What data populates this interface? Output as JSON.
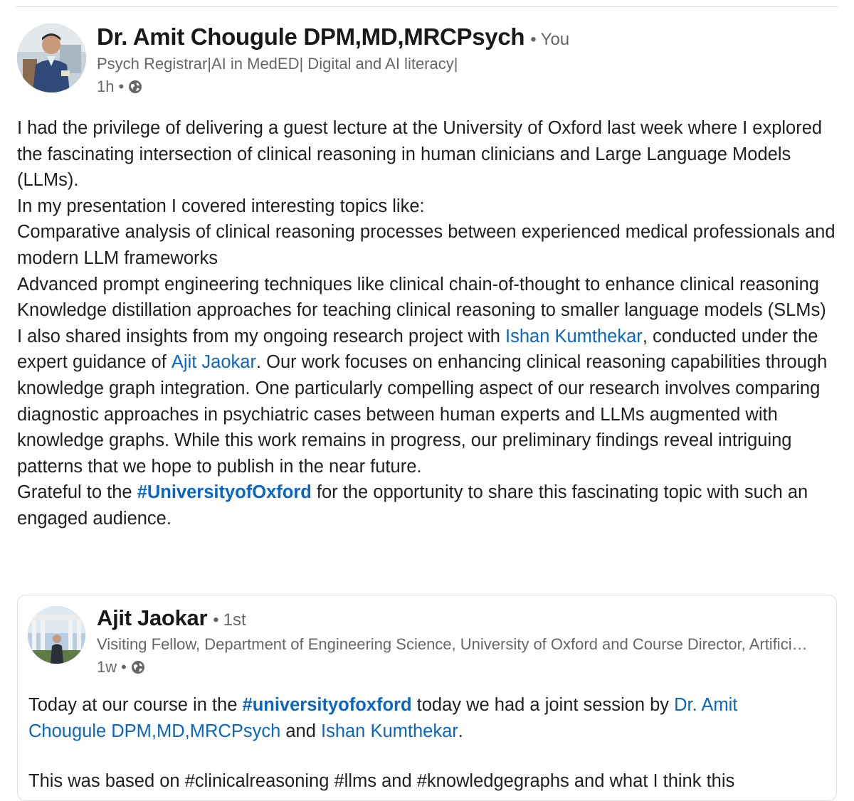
{
  "post": {
    "author": {
      "name": "Dr. Amit Chougule DPM,MD,MRCPsych",
      "separator": "•",
      "degree": "You",
      "headline": "Psych Registrar|AI in MedED| Digital and AI literacy|",
      "time": "1h",
      "meta_dot": "•",
      "visibility_icon": "globe-icon"
    },
    "body": {
      "p1": "I had the privilege of delivering a guest lecture at the University of Oxford last week where I explored the fascinating intersection of clinical reasoning in human clinicians and Large Language Models (LLMs).",
      "p2": "In my presentation I covered interesting topics like:",
      "p3": "Comparative analysis of clinical reasoning processes between experienced medical professionals and modern LLM frameworks",
      "p4": "Advanced prompt engineering techniques like clinical chain-of-thought to enhance clinical reasoning",
      "p5": "Knowledge distillation approaches for teaching clinical reasoning to smaller language models (SLMs)",
      "p6_a": "I also shared insights from my ongoing research project with ",
      "p6_link1": "Ishan Kumthekar",
      "p6_b": ", conducted under the expert guidance of ",
      "p6_link2": "Ajit Jaokar",
      "p6_c": ". Our work focuses on enhancing clinical reasoning capabilities through knowledge graph integration. One particularly compelling aspect of our research involves comparing diagnostic approaches in psychiatric cases between human experts and LLMs augmented with knowledge graphs. While this work remains in progress, our preliminary findings reveal intriguing patterns that we hope to publish in the near future.",
      "p7_a": "Grateful to the ",
      "p7_hashtag": "#UniversityofOxford",
      "p7_b": " for the opportunity to share this fascinating topic with such an engaged audience."
    }
  },
  "reshared": {
    "author": {
      "name": "Ajit Jaokar",
      "separator": "•",
      "degree": "1st",
      "headline": "Visiting Fellow, Department of Engineering Science, University of Oxford and Course Director, Artificial Intelligence: Cloud and Edge Implementations",
      "time": "1w",
      "meta_dot": "•",
      "visibility_icon": "globe-icon"
    },
    "body": {
      "a": "Today at our course in the ",
      "hashtag": "#universityofoxford",
      "b": " today we had a joint session by ",
      "link1": "Dr. Amit Chougule DPM,MD,MRCPsych",
      "c": " and ",
      "link2": "Ishan Kumthekar",
      "d": ".",
      "cutoff": "This was based on #clinicalreasoning #llms and #knowledgegraphs and what I think this"
    }
  },
  "colors": {
    "link": "#0a66c2",
    "text": "#1f1f1f",
    "muted": "#666666",
    "border": "#dedede"
  }
}
